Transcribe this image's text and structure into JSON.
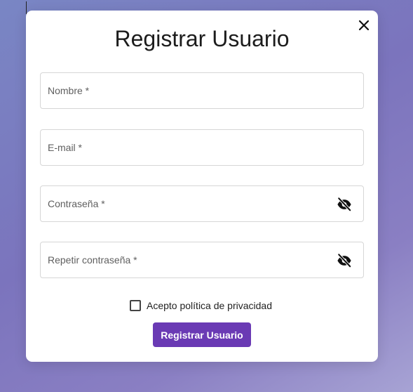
{
  "dialog": {
    "title": "Registrar Usuario",
    "close_icon": "close-icon"
  },
  "fields": [
    {
      "label": "Nombre *",
      "value": ""
    },
    {
      "label": "E-mail *",
      "value": ""
    },
    {
      "label": "Contraseña *",
      "value": "",
      "toggle_icon": "eye-off-icon"
    },
    {
      "label": "Repetir contraseña *",
      "value": "",
      "toggle_icon": "eye-off-icon"
    }
  ],
  "privacy": {
    "label": "Acepto política de privacidad",
    "checked": false
  },
  "submit": {
    "label": "Registrar Usuario"
  },
  "colors": {
    "accent": "#6a3ab4",
    "background_start": "#7986c4",
    "background_end": "#a7a3d4"
  }
}
